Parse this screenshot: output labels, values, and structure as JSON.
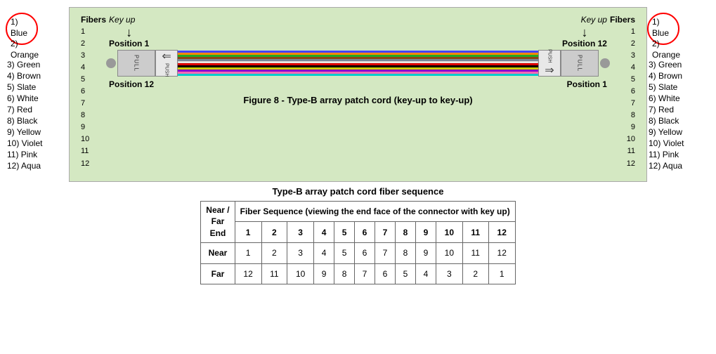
{
  "leftLegend": {
    "circleItems": [
      "1) Blue",
      "2) Orange"
    ],
    "items": [
      "3) Green",
      "4) Brown",
      "5) Slate",
      "6) White",
      "7) Red",
      "8) Black",
      "9) Yellow",
      "10) Violet",
      "11) Pink",
      "12) Aqua"
    ]
  },
  "rightLegend": {
    "circleItems": [
      "1) Blue",
      "2) Orange"
    ],
    "items": [
      "3) Green",
      "4) Brown",
      "5) Slate",
      "6) White",
      "7) Red",
      "8) Black",
      "9) Yellow",
      "10) Violet",
      "11) Pink",
      "12) Aqua"
    ]
  },
  "diagram": {
    "fibersLabel": "Fibers",
    "fiberNumbers": [
      "1",
      "2",
      "3",
      "4",
      "5",
      "6",
      "7",
      "8",
      "9",
      "10",
      "11",
      "12"
    ],
    "keyUpLabel": "Key up",
    "position1Label": "Position 1",
    "position12Label": "Position 12",
    "pullLabel": "PULL",
    "pushLabel": "PUSH",
    "figureCaption": "Figure 8 - Type-B array patch cord (key-up to key-up)"
  },
  "table": {
    "title": "Type-B array patch cord fiber sequence",
    "headers": {
      "nearFarEnd": "Near /\nFar\nEnd",
      "fiberSeq": "Fiber Sequence (viewing the end face of the connector with key up)",
      "colNumbers": [
        "1",
        "2",
        "3",
        "4",
        "5",
        "6",
        "7",
        "8",
        "9",
        "10",
        "11",
        "12"
      ]
    },
    "rows": [
      {
        "label": "Near",
        "values": [
          "1",
          "2",
          "3",
          "4",
          "5",
          "6",
          "7",
          "8",
          "9",
          "10",
          "11",
          "12"
        ]
      },
      {
        "label": "Far",
        "values": [
          "12",
          "11",
          "10",
          "9",
          "8",
          "7",
          "6",
          "5",
          "4",
          "3",
          "2",
          "1"
        ]
      }
    ]
  },
  "fiberColors": [
    "#4444ff",
    "#ff8800",
    "#22aa22",
    "#8B4513",
    "#778899",
    "#ffffff",
    "#dd0000",
    "#000000",
    "#cccc00",
    "#8800cc",
    "#ff69b4",
    "#00cccc"
  ]
}
